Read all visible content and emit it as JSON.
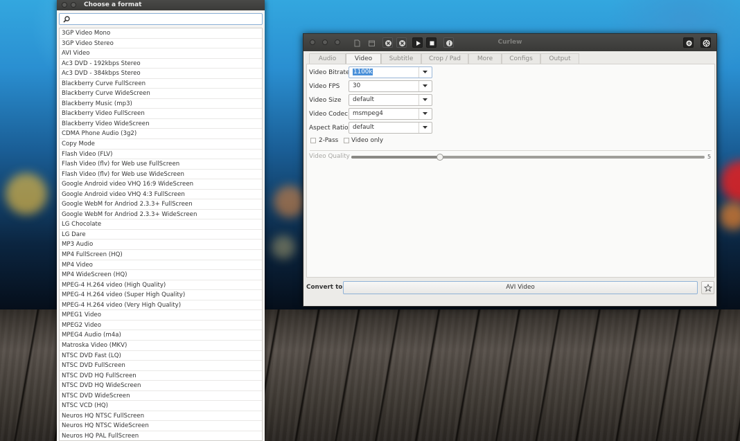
{
  "chooser": {
    "title": "Choose a format",
    "search": {
      "value": "",
      "placeholder": ""
    },
    "formats": [
      "3GP Video Mono",
      "3GP Video Stereo",
      "AVI Video",
      "Ac3 DVD - 192kbps Stereo",
      "Ac3 DVD - 384kbps Stereo",
      "Blackberry Curve FullScreen",
      "Blackberry Curve WideScreen",
      "Blackberry Music (mp3)",
      "Blackberry Video FullScreen",
      "Blackberry Video WideScreen",
      "CDMA Phone Audio (3g2)",
      "Copy Mode",
      "Flash Video (FLV)",
      "Flash Video (flv) for Web use FullScreen",
      "Flash Video (flv) for Web use WideScreen",
      "Google Android video VHQ 16:9 WideScreen",
      "Google Android video VHQ 4:3 FullScreen",
      "Google WebM for Andriod 2.3.3+ FullScreen",
      "Google WebM for Andriod 2.3.3+ WideScreen",
      "LG Chocolate",
      "LG Dare",
      "MP3 Audio",
      "MP4 FullScreen (HQ)",
      "MP4 Video",
      "MP4 WideScreen (HQ)",
      "MPEG-4 H.264 video (High Quality)",
      "MPEG-4 H.264 video (Super High Quality)",
      "MPEG-4 H.264 video (Very High Quality)",
      "MPEG1 Video",
      "MPEG2 Video",
      "MPEG4 Audio (m4a)",
      "Matroska Video (MKV)",
      "NTSC DVD Fast (LQ)",
      "NTSC DVD FullScreen",
      "NTSC DVD HQ FullScreen",
      "NTSC DVD HQ WideScreen",
      "NTSC DVD WideScreen",
      "NTSC VCD (HQ)",
      "Neuros HQ NTSC FullScreen",
      "Neuros HQ NTSC WideScreen",
      "Neuros HQ PAL FullScreen"
    ]
  },
  "curlew": {
    "title": "Curlew",
    "toolbar_icons": [
      "new-file-icon",
      "open-icon",
      "remove-icon",
      "clear-icon",
      "play-icon",
      "stop-icon",
      "info-icon",
      "settings-icon",
      "help-icon"
    ],
    "tabs": [
      {
        "label": "Audio",
        "active": false
      },
      {
        "label": "Video",
        "active": true
      },
      {
        "label": "Subtitle",
        "active": false
      },
      {
        "label": "Crop / Pad",
        "active": false
      },
      {
        "label": "More",
        "active": false
      },
      {
        "label": "Configs",
        "active": false
      },
      {
        "label": "Output",
        "active": false
      }
    ],
    "video": {
      "bitrate": {
        "label": "Video Bitrate",
        "value": "1100k"
      },
      "fps": {
        "label": "Video FPS",
        "value": "30"
      },
      "size": {
        "label": "Video Size",
        "value": "default"
      },
      "codec": {
        "label": "Video Codec",
        "value": "msmpeg4"
      },
      "aspect": {
        "label": "Aspect Ratio",
        "value": "default"
      },
      "two_pass": {
        "label": "2-Pass",
        "checked": false
      },
      "video_only": {
        "label": "Video only",
        "checked": false
      },
      "quality": {
        "label": "Video Quality",
        "value": "5",
        "fraction": 0.25
      }
    },
    "convert": {
      "label": "Convert to:",
      "value": "AVI Video"
    },
    "colors": {
      "accent": "#4a90d9",
      "titlebar": "#3b3b39",
      "panel": "#fafaf9"
    }
  }
}
